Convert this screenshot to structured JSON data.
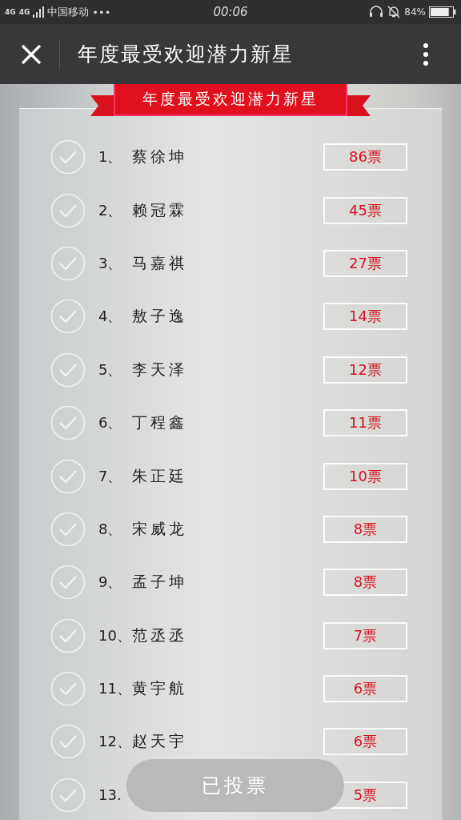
{
  "status_bar": {
    "networks": [
      "4G",
      "4G"
    ],
    "carrier": "中国移动",
    "more": "•••",
    "time": "00:06",
    "battery_text": "84%"
  },
  "header": {
    "title": "年度最受欢迎潜力新星"
  },
  "banner": {
    "title": "年度最受欢迎潜力新星"
  },
  "candidates": [
    {
      "rank": "1、",
      "name": "蔡徐坤",
      "votes": "86票",
      "checked": false
    },
    {
      "rank": "2、",
      "name": "赖冠霖",
      "votes": "45票",
      "checked": false
    },
    {
      "rank": "3、",
      "name": "马嘉祺",
      "votes": "27票",
      "checked": false
    },
    {
      "rank": "4、",
      "name": "敖子逸",
      "votes": "14票",
      "checked": false
    },
    {
      "rank": "5、",
      "name": "李天泽",
      "votes": "12票",
      "checked": false
    },
    {
      "rank": "6、",
      "name": "丁程鑫",
      "votes": "11票",
      "checked": false
    },
    {
      "rank": "7、",
      "name": "朱正廷",
      "votes": "10票",
      "checked": false
    },
    {
      "rank": "8、",
      "name": "宋威龙",
      "votes": "8票",
      "checked": false
    },
    {
      "rank": "9、",
      "name": "孟子坤",
      "votes": "8票",
      "checked": false
    },
    {
      "rank": "10、",
      "name": "范丞丞",
      "votes": "7票",
      "checked": false
    },
    {
      "rank": "11、",
      "name": "黄宇航",
      "votes": "6票",
      "checked": false
    },
    {
      "rank": "12、",
      "name": "赵天宇",
      "votes": "6票",
      "checked": false
    },
    {
      "rank": "13.",
      "votes": "5票",
      "checked": false
    }
  ],
  "vote_button": {
    "label": "已投票",
    "disabled": true
  }
}
